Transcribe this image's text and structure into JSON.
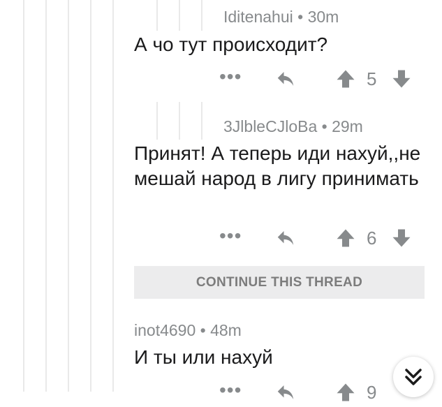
{
  "comments": [
    {
      "author": "Iditenahui",
      "age": "30m",
      "text": "А чо тут происходит?",
      "score": "5"
    },
    {
      "author": "3JlbleCJloBa",
      "age": "29m",
      "text": "Принят! А теперь иди нахуй,,не мешай народ в лигу принимать",
      "score": "6"
    },
    {
      "author": "inot4690",
      "age": "48m",
      "text": "И ты или нахуй",
      "score": "9"
    }
  ],
  "separator": "•",
  "more_glyph": "•••",
  "continue_thread_label": "CONTINUE THIS THREAD",
  "icons": {
    "more": "more-options-icon",
    "reply": "reply-arrow-icon",
    "upvote": "upvote-arrow-icon",
    "downvote": "downvote-arrow-icon",
    "scroll": "double-chevron-down-icon"
  },
  "colors": {
    "icon": "#878a8c",
    "button_bg": "#ececed",
    "thread_line": "#e9e9e9"
  }
}
